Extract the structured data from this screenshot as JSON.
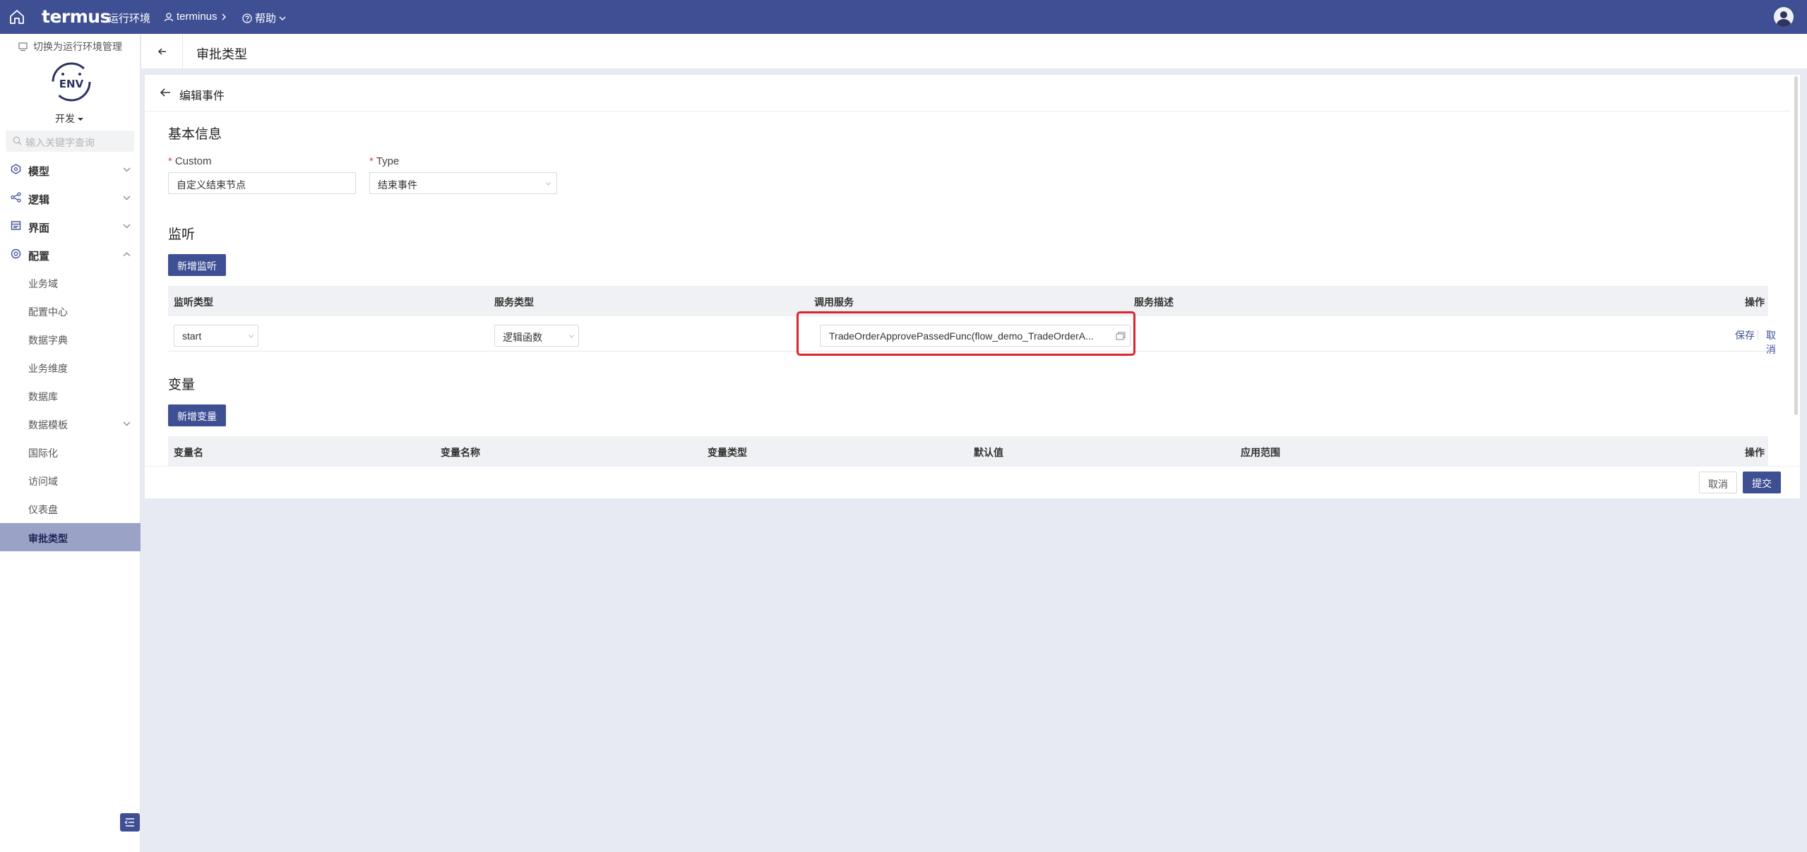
{
  "topbar": {
    "logo": "termus",
    "env_label": "运行环境",
    "project": "terminus",
    "help": "帮助"
  },
  "sidebar": {
    "switch_env": "切换为运行环境管理",
    "env_logo_text": "ENV",
    "env_name": "开发",
    "search_placeholder": "输入关键字查询",
    "groups": [
      {
        "label": "模型",
        "icon": "cube-icon",
        "expanded": false
      },
      {
        "label": "逻辑",
        "icon": "share-icon",
        "expanded": false
      },
      {
        "label": "界面",
        "icon": "layout-icon",
        "expanded": false
      },
      {
        "label": "配置",
        "icon": "settings-icon",
        "expanded": true
      }
    ],
    "config_items": [
      "业务域",
      "配置中心",
      "数据字典",
      "业务维度",
      "数据库",
      "数据模板",
      "国际化",
      "访问域",
      "仪表盘",
      "审批类型"
    ],
    "active_item": "审批类型"
  },
  "page": {
    "title": "审批类型"
  },
  "editor": {
    "title": "编辑事件",
    "basic": {
      "section": "基本信息",
      "custom_label": "Custom",
      "custom_value": "自定义结束节点",
      "type_label": "Type",
      "type_value": "结束事件"
    },
    "listen": {
      "section": "监听",
      "add_button": "新增监听",
      "columns": [
        "监听类型",
        "服务类型",
        "调用服务",
        "服务描述",
        "操作"
      ],
      "row": {
        "listen_type": "start",
        "service_type": "逻辑函数",
        "service": "TradeOrderApprovePassedFunc(flow_demo_TradeOrderA...",
        "description": "",
        "save": "保存",
        "cancel": "取消"
      }
    },
    "variables": {
      "section": "变量",
      "add_button": "新增变量",
      "columns": [
        "变量名",
        "变量名称",
        "变量类型",
        "默认值",
        "应用范围",
        "操作"
      ]
    },
    "footer": {
      "cancel": "取消",
      "submit": "提交"
    }
  },
  "colors": {
    "primary": "#3f4f94",
    "highlight": "#d9262b",
    "active_nav": "#9aa2c6"
  }
}
